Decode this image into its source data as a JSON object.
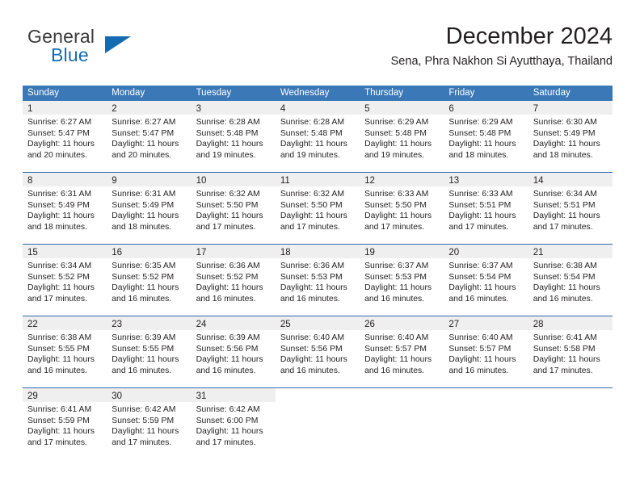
{
  "brand": {
    "name_top": "General",
    "name_bottom": "Blue",
    "color_dark": "#3b3b3b",
    "color_blue": "#156bb1",
    "triangle_icon": "triangle-icon"
  },
  "header": {
    "title": "December 2024",
    "subtitle": "Sena, Phra Nakhon Si Ayutthaya, Thailand"
  },
  "theme": {
    "header_blue": "#3b78b7",
    "row_border_blue": "#2f6bab",
    "daynum_band": "#efefef",
    "text": "#231f20"
  },
  "calendar": {
    "weekdays": [
      "Sunday",
      "Monday",
      "Tuesday",
      "Wednesday",
      "Thursday",
      "Friday",
      "Saturday"
    ],
    "weeks": [
      [
        {
          "day": "1",
          "sunrise": "Sunrise: 6:27 AM",
          "sunset": "Sunset: 5:47 PM",
          "daylight1": "Daylight: 11 hours",
          "daylight2": "and 20 minutes."
        },
        {
          "day": "2",
          "sunrise": "Sunrise: 6:27 AM",
          "sunset": "Sunset: 5:47 PM",
          "daylight1": "Daylight: 11 hours",
          "daylight2": "and 20 minutes."
        },
        {
          "day": "3",
          "sunrise": "Sunrise: 6:28 AM",
          "sunset": "Sunset: 5:48 PM",
          "daylight1": "Daylight: 11 hours",
          "daylight2": "and 19 minutes."
        },
        {
          "day": "4",
          "sunrise": "Sunrise: 6:28 AM",
          "sunset": "Sunset: 5:48 PM",
          "daylight1": "Daylight: 11 hours",
          "daylight2": "and 19 minutes."
        },
        {
          "day": "5",
          "sunrise": "Sunrise: 6:29 AM",
          "sunset": "Sunset: 5:48 PM",
          "daylight1": "Daylight: 11 hours",
          "daylight2": "and 19 minutes."
        },
        {
          "day": "6",
          "sunrise": "Sunrise: 6:29 AM",
          "sunset": "Sunset: 5:48 PM",
          "daylight1": "Daylight: 11 hours",
          "daylight2": "and 18 minutes."
        },
        {
          "day": "7",
          "sunrise": "Sunrise: 6:30 AM",
          "sunset": "Sunset: 5:49 PM",
          "daylight1": "Daylight: 11 hours",
          "daylight2": "and 18 minutes."
        }
      ],
      [
        {
          "day": "8",
          "sunrise": "Sunrise: 6:31 AM",
          "sunset": "Sunset: 5:49 PM",
          "daylight1": "Daylight: 11 hours",
          "daylight2": "and 18 minutes."
        },
        {
          "day": "9",
          "sunrise": "Sunrise: 6:31 AM",
          "sunset": "Sunset: 5:49 PM",
          "daylight1": "Daylight: 11 hours",
          "daylight2": "and 18 minutes."
        },
        {
          "day": "10",
          "sunrise": "Sunrise: 6:32 AM",
          "sunset": "Sunset: 5:50 PM",
          "daylight1": "Daylight: 11 hours",
          "daylight2": "and 17 minutes."
        },
        {
          "day": "11",
          "sunrise": "Sunrise: 6:32 AM",
          "sunset": "Sunset: 5:50 PM",
          "daylight1": "Daylight: 11 hours",
          "daylight2": "and 17 minutes."
        },
        {
          "day": "12",
          "sunrise": "Sunrise: 6:33 AM",
          "sunset": "Sunset: 5:50 PM",
          "daylight1": "Daylight: 11 hours",
          "daylight2": "and 17 minutes."
        },
        {
          "day": "13",
          "sunrise": "Sunrise: 6:33 AM",
          "sunset": "Sunset: 5:51 PM",
          "daylight1": "Daylight: 11 hours",
          "daylight2": "and 17 minutes."
        },
        {
          "day": "14",
          "sunrise": "Sunrise: 6:34 AM",
          "sunset": "Sunset: 5:51 PM",
          "daylight1": "Daylight: 11 hours",
          "daylight2": "and 17 minutes."
        }
      ],
      [
        {
          "day": "15",
          "sunrise": "Sunrise: 6:34 AM",
          "sunset": "Sunset: 5:52 PM",
          "daylight1": "Daylight: 11 hours",
          "daylight2": "and 17 minutes."
        },
        {
          "day": "16",
          "sunrise": "Sunrise: 6:35 AM",
          "sunset": "Sunset: 5:52 PM",
          "daylight1": "Daylight: 11 hours",
          "daylight2": "and 16 minutes."
        },
        {
          "day": "17",
          "sunrise": "Sunrise: 6:36 AM",
          "sunset": "Sunset: 5:52 PM",
          "daylight1": "Daylight: 11 hours",
          "daylight2": "and 16 minutes."
        },
        {
          "day": "18",
          "sunrise": "Sunrise: 6:36 AM",
          "sunset": "Sunset: 5:53 PM",
          "daylight1": "Daylight: 11 hours",
          "daylight2": "and 16 minutes."
        },
        {
          "day": "19",
          "sunrise": "Sunrise: 6:37 AM",
          "sunset": "Sunset: 5:53 PM",
          "daylight1": "Daylight: 11 hours",
          "daylight2": "and 16 minutes."
        },
        {
          "day": "20",
          "sunrise": "Sunrise: 6:37 AM",
          "sunset": "Sunset: 5:54 PM",
          "daylight1": "Daylight: 11 hours",
          "daylight2": "and 16 minutes."
        },
        {
          "day": "21",
          "sunrise": "Sunrise: 6:38 AM",
          "sunset": "Sunset: 5:54 PM",
          "daylight1": "Daylight: 11 hours",
          "daylight2": "and 16 minutes."
        }
      ],
      [
        {
          "day": "22",
          "sunrise": "Sunrise: 6:38 AM",
          "sunset": "Sunset: 5:55 PM",
          "daylight1": "Daylight: 11 hours",
          "daylight2": "and 16 minutes."
        },
        {
          "day": "23",
          "sunrise": "Sunrise: 6:39 AM",
          "sunset": "Sunset: 5:55 PM",
          "daylight1": "Daylight: 11 hours",
          "daylight2": "and 16 minutes."
        },
        {
          "day": "24",
          "sunrise": "Sunrise: 6:39 AM",
          "sunset": "Sunset: 5:56 PM",
          "daylight1": "Daylight: 11 hours",
          "daylight2": "and 16 minutes."
        },
        {
          "day": "25",
          "sunrise": "Sunrise: 6:40 AM",
          "sunset": "Sunset: 5:56 PM",
          "daylight1": "Daylight: 11 hours",
          "daylight2": "and 16 minutes."
        },
        {
          "day": "26",
          "sunrise": "Sunrise: 6:40 AM",
          "sunset": "Sunset: 5:57 PM",
          "daylight1": "Daylight: 11 hours",
          "daylight2": "and 16 minutes."
        },
        {
          "day": "27",
          "sunrise": "Sunrise: 6:40 AM",
          "sunset": "Sunset: 5:57 PM",
          "daylight1": "Daylight: 11 hours",
          "daylight2": "and 16 minutes."
        },
        {
          "day": "28",
          "sunrise": "Sunrise: 6:41 AM",
          "sunset": "Sunset: 5:58 PM",
          "daylight1": "Daylight: 11 hours",
          "daylight2": "and 17 minutes."
        }
      ],
      [
        {
          "day": "29",
          "sunrise": "Sunrise: 6:41 AM",
          "sunset": "Sunset: 5:59 PM",
          "daylight1": "Daylight: 11 hours",
          "daylight2": "and 17 minutes."
        },
        {
          "day": "30",
          "sunrise": "Sunrise: 6:42 AM",
          "sunset": "Sunset: 5:59 PM",
          "daylight1": "Daylight: 11 hours",
          "daylight2": "and 17 minutes."
        },
        {
          "day": "31",
          "sunrise": "Sunrise: 6:42 AM",
          "sunset": "Sunset: 6:00 PM",
          "daylight1": "Daylight: 11 hours",
          "daylight2": "and 17 minutes."
        },
        {
          "day": "",
          "sunrise": "",
          "sunset": "",
          "daylight1": "",
          "daylight2": ""
        },
        {
          "day": "",
          "sunrise": "",
          "sunset": "",
          "daylight1": "",
          "daylight2": ""
        },
        {
          "day": "",
          "sunrise": "",
          "sunset": "",
          "daylight1": "",
          "daylight2": ""
        },
        {
          "day": "",
          "sunrise": "",
          "sunset": "",
          "daylight1": "",
          "daylight2": ""
        }
      ]
    ]
  }
}
